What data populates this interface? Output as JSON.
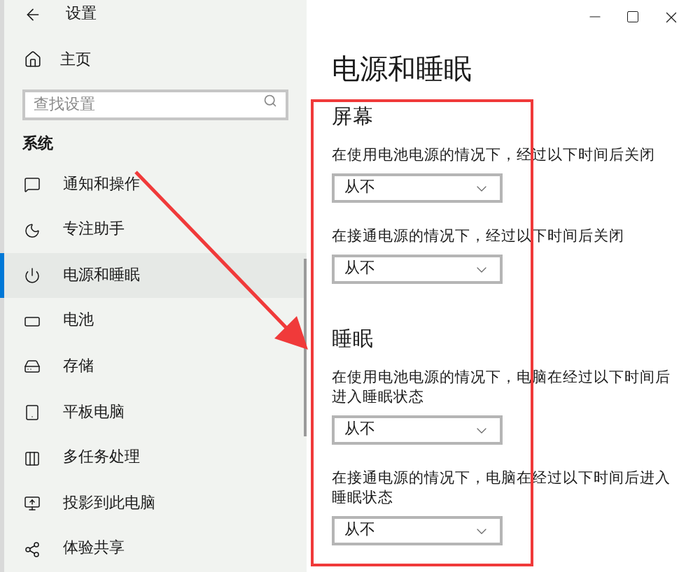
{
  "window": {
    "title": "设置"
  },
  "sidebar": {
    "home": "主页",
    "search": {
      "placeholder": "查找设置"
    },
    "section": "系统",
    "items": [
      {
        "label": "通知和操作",
        "selected": false
      },
      {
        "label": "专注助手",
        "selected": false
      },
      {
        "label": "电源和睡眠",
        "selected": true
      },
      {
        "label": "电池",
        "selected": false
      },
      {
        "label": "存储",
        "selected": false
      },
      {
        "label": "平板电脑",
        "selected": false
      },
      {
        "label": "多任务处理",
        "selected": false
      },
      {
        "label": "投影到此电脑",
        "selected": false
      },
      {
        "label": "体验共享",
        "selected": false
      }
    ]
  },
  "content": {
    "title": "电源和睡眠",
    "sections": [
      {
        "heading": "屏幕",
        "settings": [
          {
            "label": "在使用电池电源的情况下，经过以下时间后关闭",
            "value": "从不"
          },
          {
            "label": "在接通电源的情况下，经过以下时间后关闭",
            "value": "从不"
          }
        ]
      },
      {
        "heading": "睡眠",
        "settings": [
          {
            "label": "在使用电池电源的情况下，电脑在经过以下时间后进入睡眠状态",
            "value": "从不"
          },
          {
            "label": "在接通电源的情况下，电脑在经过以下时间后进入睡眠状态",
            "value": "从不"
          }
        ]
      }
    ]
  }
}
